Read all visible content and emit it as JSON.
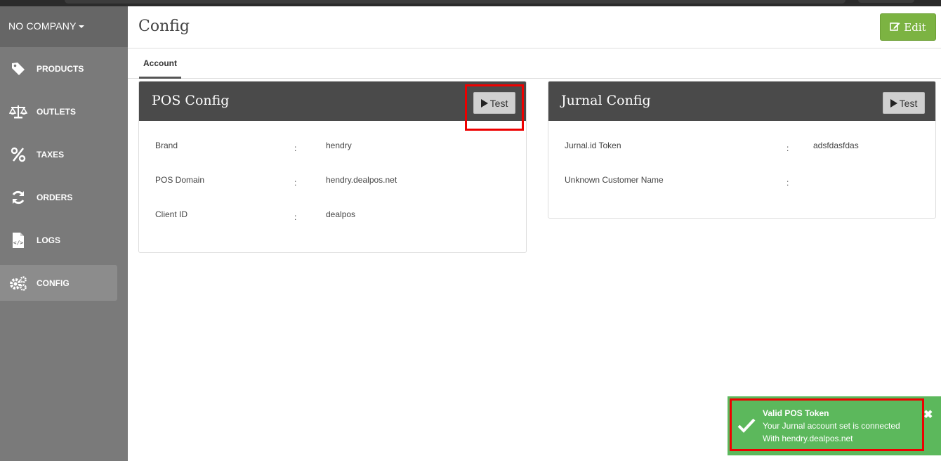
{
  "company": {
    "label": "NO COMPANY"
  },
  "sidebar": {
    "items": [
      {
        "label": "PRODUCTS",
        "icon": "tag-icon"
      },
      {
        "label": "OUTLETS",
        "icon": "balance-scale-icon"
      },
      {
        "label": "TAXES",
        "icon": "percent-icon"
      },
      {
        "label": "ORDERS",
        "icon": "refresh-icon"
      },
      {
        "label": "LOGS",
        "icon": "code-file-icon"
      },
      {
        "label": "CONFIG",
        "icon": "cogs-icon",
        "active": true
      }
    ]
  },
  "header": {
    "title": "Config",
    "edit_label": "Edit"
  },
  "tabs": [
    {
      "label": "Account",
      "active": true
    }
  ],
  "pos_config": {
    "title": "POS Config",
    "test_label": "Test",
    "rows": [
      {
        "label": "Brand",
        "sep": ":",
        "value": "hendry"
      },
      {
        "label": "POS Domain",
        "sep": ":",
        "value": "hendry.dealpos.net"
      },
      {
        "label": "Client ID",
        "sep": ":",
        "value": "dealpos"
      }
    ]
  },
  "jurnal_config": {
    "title": "Jurnal Config",
    "test_label": "Test",
    "rows": [
      {
        "label": "Jurnal.id Token",
        "sep": ":",
        "value": "adsfdasfdas"
      },
      {
        "label": "Unknown Customer Name",
        "sep": ":",
        "value": ""
      }
    ]
  },
  "toast": {
    "title": "Valid POS Token",
    "line1": "Your Jurnal account set is connected",
    "line2": "With hendry.dealpos.net",
    "close": "✖"
  },
  "colors": {
    "accent": "#7cb342",
    "toast": "#5cb85c",
    "sidebar": "#7a7a7a",
    "highlight": "#e00000"
  }
}
